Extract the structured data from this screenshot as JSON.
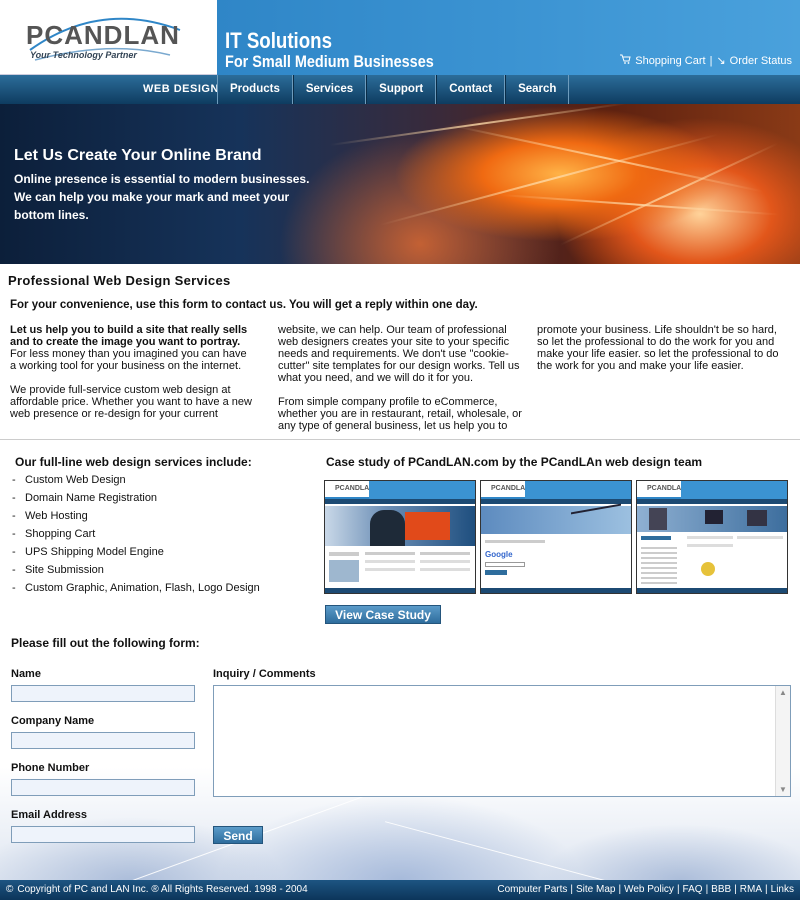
{
  "header": {
    "logo_text": "PCANDLAN",
    "logo_tagline": "Your Technology Partner",
    "title": "IT Solutions",
    "subtitle": "For Small Medium Businesses",
    "shopping_cart": "Shopping Cart",
    "separator": "|",
    "order_status": "Order Status"
  },
  "nav": {
    "section": "WEB DESIGN",
    "items": [
      "Products",
      "Services",
      "Support",
      "Contact",
      "Search"
    ]
  },
  "hero": {
    "title": "Let Us Create Your Online Brand",
    "text": "Online presence is essential to modern businesses. We can help you make your mark and meet your bottom lines."
  },
  "content": {
    "section_title": "Professional Web Design Services",
    "lead": "For your convenience, use this form to contact us.  You will get a reply within one day.",
    "col1_bold": "Let us help you to build a site that really sells and to create the image you want to portray.",
    "col1_text": " For less money than you imagined you can have a working tool for your business on the internet.",
    "col1_p2": "We provide full-service custom web design at affordable price.  Whether you want to have a new web presence or re-design for your current",
    "col2_p1": "website, we can help.  Our team of professional web designers creates your site to your specific needs and requirements.  We don't use \"cookie-cutter\" site templates for our design works.  Tell us what you need, and we will do it for you.",
    "col2_p2": " From simple company profile to eCommerce, whether you are in restaurant, retail, wholesale, or any type of general business, let us help you to",
    "col3_p1": "promote your business.  Life shouldn't be so hard, so let the professional to do the work for you and make your life easier. so let the professional to do the work for you and make your life easier."
  },
  "services": {
    "title": "Our full-line web design services include:",
    "items": [
      "Custom Web Design",
      "Domain Name Registration",
      "Web Hosting",
      "Shopping Cart",
      "UPS Shipping Model Engine",
      "Site Submission",
      "Custom Graphic, Animation, Flash, Logo Design"
    ]
  },
  "case_study": {
    "title": "Case study of PCandLAN.com by the PCandLAn web design team",
    "button": "View Case Study"
  },
  "form": {
    "title": "Please fill out the following form:",
    "name_label": "Name",
    "company_label": "Company Name",
    "phone_label": "Phone Number",
    "email_label": "Email Address",
    "comments_label": "Inquiry / Comments",
    "send": "Send"
  },
  "footer": {
    "copyright": "Copyright of PC and LAN Inc. ® All Rights Reserved. 1998 - 2004",
    "links": [
      "Computer Parts",
      "Site Map",
      "Web Policy",
      "FAQ",
      "BBB",
      "RMA",
      "Links"
    ]
  }
}
